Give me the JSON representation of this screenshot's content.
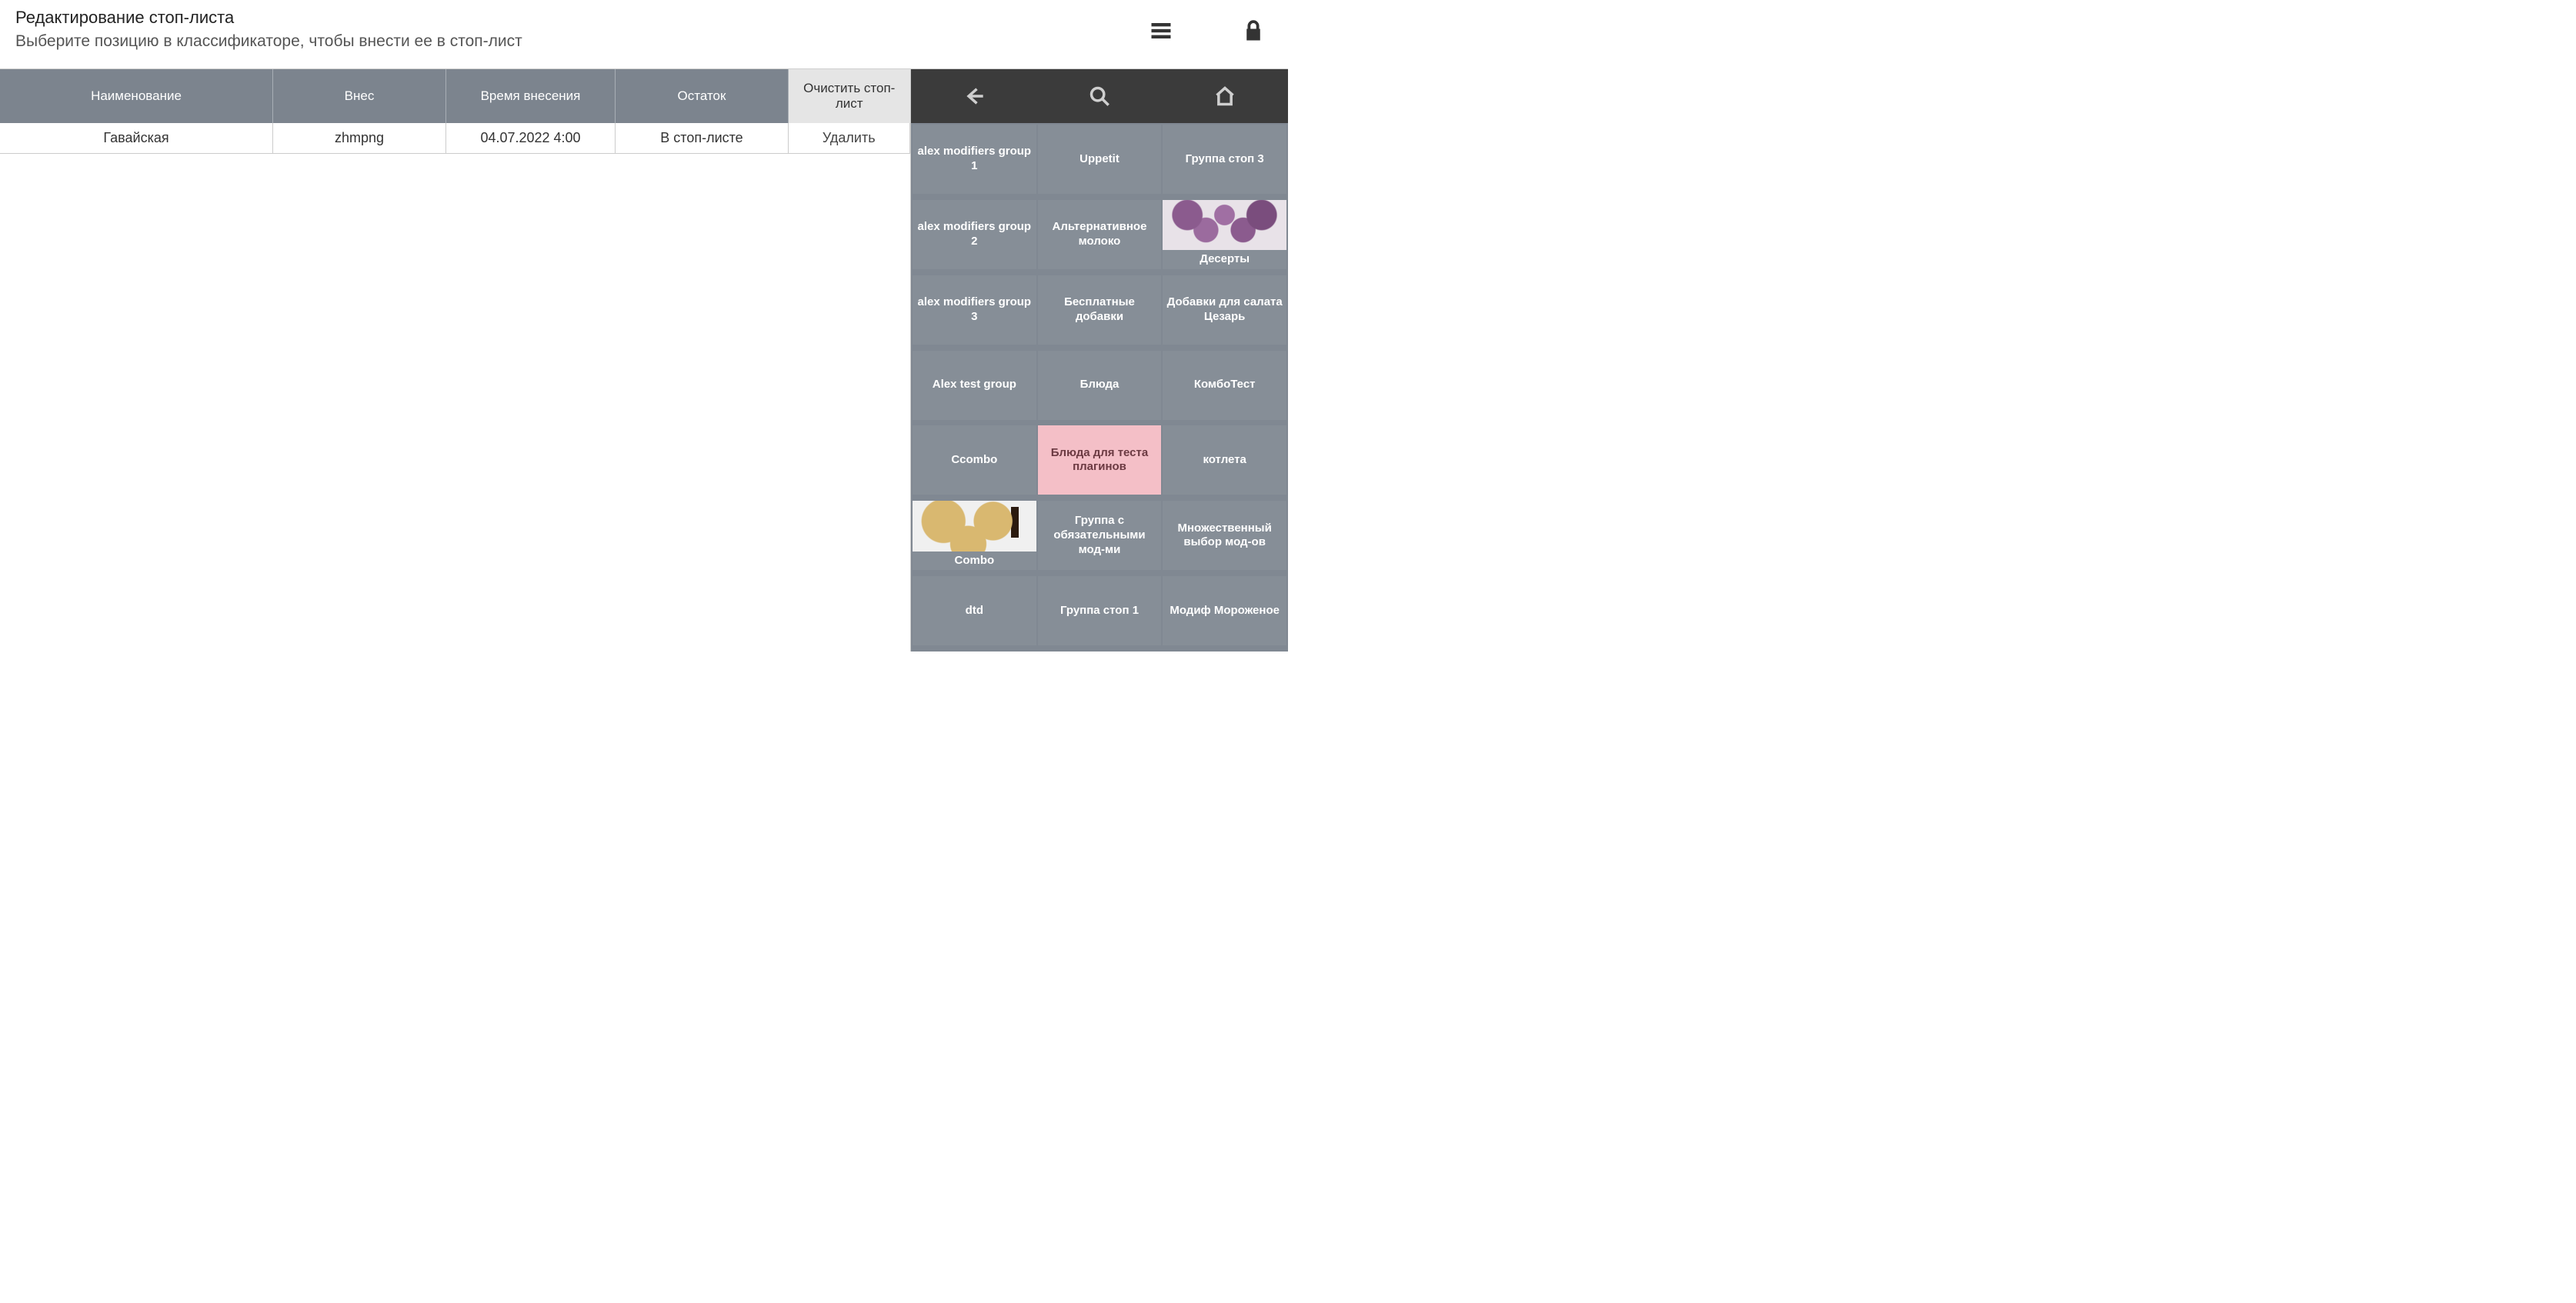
{
  "header": {
    "title": "Редактирование стоп-листа",
    "subtitle": "Выберите позицию в классификаторе, чтобы внести ее в стоп-лист"
  },
  "table": {
    "headers": {
      "name": "Наименование",
      "user": "Внес",
      "time": "Время внесения",
      "stock": "Остаток",
      "action": "Очистить стоп-лист"
    },
    "rows": [
      {
        "name": "Гавайская",
        "user": "zhmpng",
        "time": "04.07.2022 4:00",
        "stock": "В стоп-листе",
        "action": "Удалить"
      }
    ]
  },
  "categories": [
    {
      "label": "alex modifiers group 1",
      "type": "normal"
    },
    {
      "label": "Uppetit",
      "type": "normal"
    },
    {
      "label": "Группа стоп 3",
      "type": "normal"
    },
    {
      "label": "alex modifiers group 2",
      "type": "normal"
    },
    {
      "label": "Альтернативное молоко",
      "type": "normal"
    },
    {
      "label": "Десерты",
      "type": "image-dessert"
    },
    {
      "label": "alex modifiers group 3",
      "type": "normal"
    },
    {
      "label": "Бесплатные добавки",
      "type": "normal"
    },
    {
      "label": "Добавки для салата Цезарь",
      "type": "normal"
    },
    {
      "label": "Alex test group",
      "type": "normal"
    },
    {
      "label": "Блюда",
      "type": "normal"
    },
    {
      "label": "КомбоТест",
      "type": "normal"
    },
    {
      "label": "Ccombo",
      "type": "normal"
    },
    {
      "label": "Блюда для теста плагинов",
      "type": "pink"
    },
    {
      "label": "котлета",
      "type": "normal"
    },
    {
      "label": "Combo",
      "type": "image-combo"
    },
    {
      "label": "Группа с обязательными мод-ми",
      "type": "normal"
    },
    {
      "label": "Множественный выбор мод-ов",
      "type": "normal"
    },
    {
      "label": "dtd",
      "type": "normal"
    },
    {
      "label": "Группа стоп 1",
      "type": "normal"
    },
    {
      "label": "Модиф Мороженое",
      "type": "normal"
    }
  ]
}
